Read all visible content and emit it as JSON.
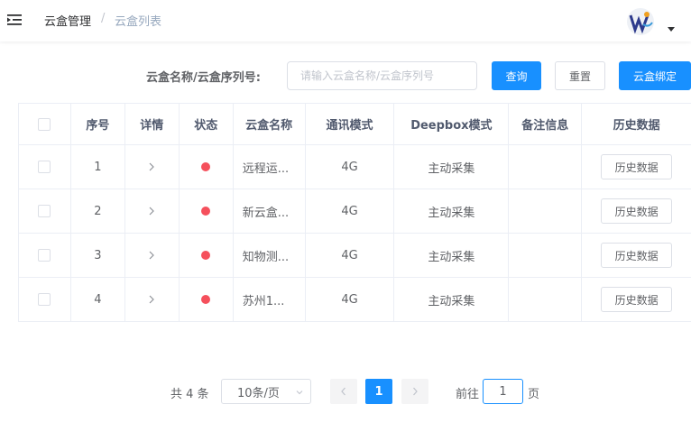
{
  "breadcrumb": {
    "parent": "云盒管理",
    "separator": "/",
    "current": "云盒列表"
  },
  "search": {
    "label": "云盒名称/云盒序列号:",
    "placeholder": "请输入云盒名称/云盒序列号",
    "value": ""
  },
  "buttons": {
    "query": "查询",
    "reset": "重置",
    "bind": "云盒绑定"
  },
  "table": {
    "headers": [
      "",
      "序号",
      "详情",
      "状态",
      "云盒名称",
      "通讯模式",
      "Deepbox模式",
      "备注信息",
      "历史数据"
    ],
    "rows": [
      {
        "index": "1",
        "name": "远程运...",
        "comm": "4G",
        "mode": "主动采集",
        "remark": "",
        "history": "历史数据",
        "status_color": "#f5505c"
      },
      {
        "index": "2",
        "name": "新云盒...",
        "comm": "4G",
        "mode": "主动采集",
        "remark": "",
        "history": "历史数据",
        "status_color": "#f5505c"
      },
      {
        "index": "3",
        "name": "知物测...",
        "comm": "4G",
        "mode": "主动采集",
        "remark": "",
        "history": "历史数据",
        "status_color": "#f5505c"
      },
      {
        "index": "4",
        "name": "苏州1...",
        "comm": "4G",
        "mode": "主动采集",
        "remark": "",
        "history": "历史数据",
        "status_color": "#f5505c"
      }
    ]
  },
  "pagination": {
    "total": "共 4 条",
    "page_size": "10条/页",
    "current_page": "1",
    "goto_label": "前往",
    "goto_value": "1",
    "goto_unit": "页"
  },
  "colors": {
    "primary": "#1890ff",
    "status_offline": "#f5505c"
  },
  "icons": {
    "menu": "menu-fold-icon",
    "avatar": "user-avatar-logo",
    "caret": "caret-down-icon",
    "detail": "chevron-right-icon"
  }
}
